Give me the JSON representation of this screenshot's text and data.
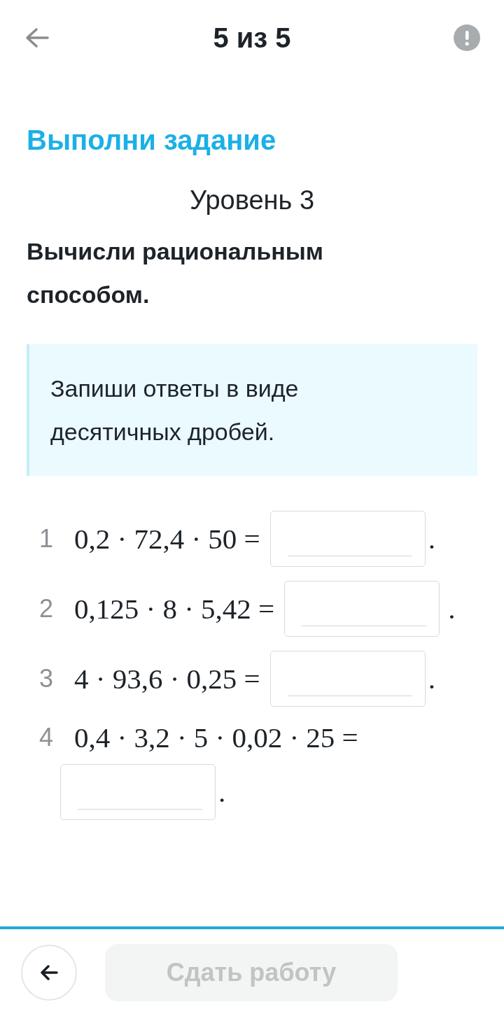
{
  "header": {
    "title": "5 из 5"
  },
  "task": {
    "heading": "Выполни задание",
    "level": "Уровень 3",
    "instruction": "Вычисли рациональным способом.",
    "hint": "Запиши ответы в виде десятичных дробей."
  },
  "problems": [
    {
      "number": "1",
      "expression": "0,2 · 72,4 · 50 =",
      "end": "."
    },
    {
      "number": "2",
      "expression": "0,125 · 8 · 5,42 =",
      "end": "."
    },
    {
      "number": "3",
      "expression": "4 · 93,6 · 0,25 =",
      "end": "."
    },
    {
      "number": "4",
      "expression": "0,4 · 3,2 · 5 · 0,02 · 25 =",
      "end": "."
    }
  ],
  "footer": {
    "submit": {
      "label": "Сдать работу",
      "disabled": true
    }
  }
}
